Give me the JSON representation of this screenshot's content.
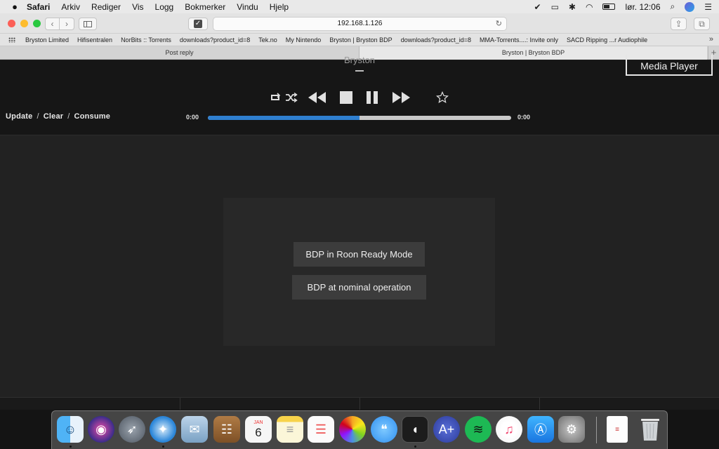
{
  "menubar": {
    "apple": "",
    "items": [
      "Safari",
      "Arkiv",
      "Rediger",
      "Vis",
      "Logg",
      "Bokmerker",
      "Vindu",
      "Hjelp"
    ],
    "clock": "lør. 12:06"
  },
  "toolbar": {
    "url": "192.168.1.126",
    "back_icon": "‹",
    "forward_icon": "›",
    "check_icon": "✓",
    "reload_icon": "↻",
    "share_icon": "⇪",
    "tabs_icon": "⧉"
  },
  "bookmarks": [
    "Bryston Limited",
    "Hifisentralen",
    "NorBits :: Torrents",
    "downloads?product_id=8",
    "Tek.no",
    "My Nintendo",
    "Bryston | Bryston BDP",
    "downloads?product_id=8",
    "MMA-Torrents....: Invite only",
    "SACD Ripping ...r Audiophile"
  ],
  "bookmarks_more": "»",
  "tabs": [
    {
      "label": "Post reply",
      "active": false
    },
    {
      "label": "Bryston | Bryston BDP",
      "active": true
    }
  ],
  "tab_add": "+",
  "player": {
    "brand": "Bryston",
    "media_player_label": "Media Player",
    "links": [
      "Update",
      "Clear",
      "Consume"
    ],
    "link_separator": "/",
    "time_elapsed": "0:00",
    "time_total": "0:00",
    "progress_fraction": 0.5
  },
  "panel": {
    "button_roon": "BDP in Roon Ready Mode",
    "button_nominal": "BDP at nominal operation"
  },
  "dock": {
    "apps": [
      "finder",
      "siri",
      "launchpad",
      "safari",
      "mail",
      "contacts",
      "calendar",
      "notes",
      "reminders",
      "photos",
      "messages",
      "roon",
      "audirvana",
      "spotify",
      "itunes",
      "app-store",
      "system-preferences"
    ],
    "calendar_month": "JAN",
    "calendar_day": "6"
  },
  "colors": {
    "accent": "#2f7fd0",
    "page_bg": "#222222",
    "header_bg": "#161616"
  }
}
